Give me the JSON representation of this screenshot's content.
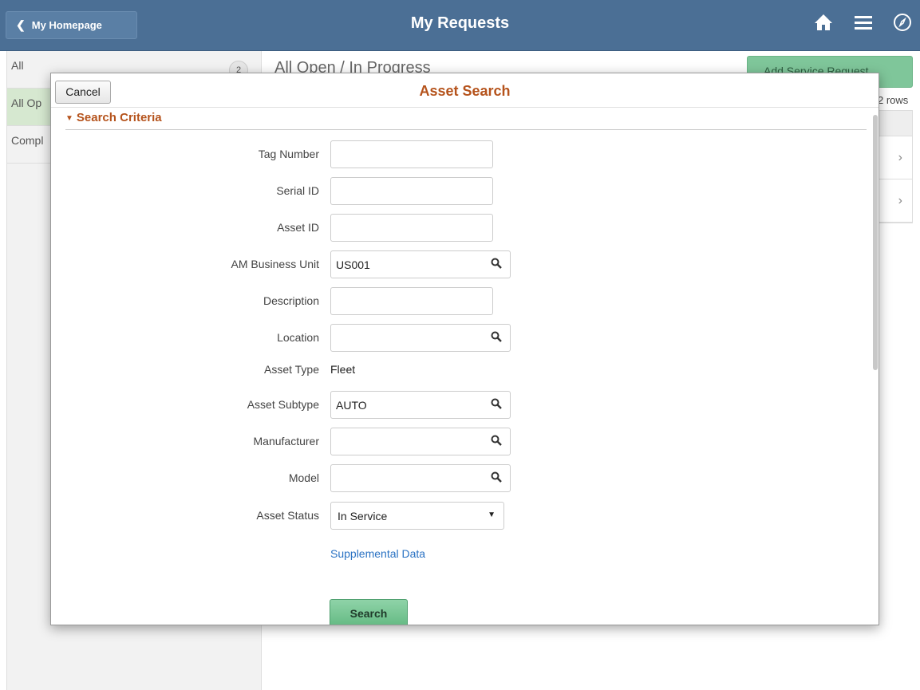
{
  "banner": {
    "back_label": "My Homepage",
    "title": "My Requests",
    "icons": [
      "home-icon",
      "menu-icon",
      "navbar-icon"
    ]
  },
  "sidebar": {
    "items": [
      {
        "label": "All",
        "badge": "2"
      },
      {
        "label": "All Op",
        "badge": ""
      },
      {
        "label": "Compl",
        "badge": ""
      }
    ]
  },
  "main": {
    "title": "All Open / In Progress",
    "add_button": "Add Service Request",
    "rows_label": "2 rows"
  },
  "modal": {
    "cancel_label": "Cancel",
    "title": "Asset Search",
    "section_title": "Search Criteria",
    "fields": {
      "tag_number": {
        "label": "Tag Number",
        "value": ""
      },
      "serial_id": {
        "label": "Serial ID",
        "value": ""
      },
      "asset_id": {
        "label": "Asset ID",
        "value": ""
      },
      "am_business_unit": {
        "label": "AM Business Unit",
        "value": "US001"
      },
      "description": {
        "label": "Description",
        "value": ""
      },
      "location": {
        "label": "Location",
        "value": ""
      },
      "asset_type": {
        "label": "Asset Type",
        "value": "Fleet"
      },
      "asset_subtype": {
        "label": "Asset Subtype",
        "value": "AUTO"
      },
      "manufacturer": {
        "label": "Manufacturer",
        "value": ""
      },
      "model": {
        "label": "Model",
        "value": ""
      },
      "asset_status": {
        "label": "Asset Status",
        "value": "In Service"
      }
    },
    "supplemental_link": "Supplemental Data",
    "search_button": "Search"
  },
  "colors": {
    "banner": "#4b6f95",
    "accent_orange": "#b5531c",
    "search_green": "#63b982",
    "link_blue": "#2a72c3"
  }
}
